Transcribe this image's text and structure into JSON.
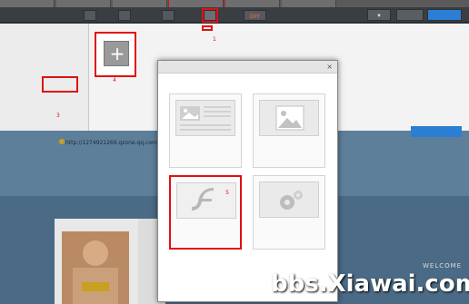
{
  "toolbar": {
    "site_name": "",
    "nav": [
      "",
      "",
      "",
      "",
      "DIY"
    ],
    "active_nav_index": 3,
    "links": [
      "",
      ""
    ],
    "preview_label": "",
    "save_label": "",
    "accent_color": "#2a7fd4",
    "highlight_color": "#e01010"
  },
  "left_panel": {
    "items": [
      "",
      "",
      "",
      ""
    ],
    "badge_3": "3"
  },
  "content": {
    "module_prompt": "",
    "custom_module_label": "",
    "badge_1": "1",
    "add_tile_icon": "plus-icon",
    "add_caption": "",
    "badge_4": "4"
  },
  "blog": {
    "url": "http://1274921269.qzone.qq.com",
    "custom_bg_label": "",
    "nav_text": "",
    "profile_title": ""
  },
  "modal": {
    "title": "",
    "question": "",
    "cards": [
      {
        "icon": "text-image-icon",
        "desc": ""
      },
      {
        "icon": "image-icon",
        "desc": ""
      },
      {
        "icon": "flash-icon",
        "desc": "",
        "badge": "5",
        "selected": true
      },
      {
        "icon": "gear-icon",
        "desc": ""
      }
    ]
  },
  "watermark": {
    "line1": "",
    "line2": "bbs.Xiawai.com",
    "welcome": "WELCOME"
  }
}
